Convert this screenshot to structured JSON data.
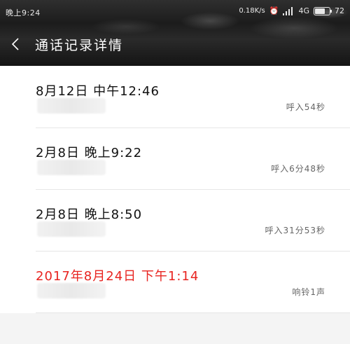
{
  "status_bar": {
    "time": "晚上9:24",
    "net_speed": "0.18K/s",
    "network": "4G",
    "battery": "72",
    "battery_level": 0.72
  },
  "header": {
    "title": "通话记录详情",
    "back_icon": "chevron-left-icon"
  },
  "records": [
    {
      "time": "8月12日 中午12:46",
      "desc": "呼入54秒",
      "missed": false
    },
    {
      "time": "2月8日 晚上9:22",
      "desc": "呼入6分48秒",
      "missed": false
    },
    {
      "time": "2月8日 晚上8:50",
      "desc": "呼入31分53秒",
      "missed": false
    },
    {
      "time": "2017年8月24日 下午1:14",
      "desc": "响铃1声",
      "missed": true
    }
  ],
  "colors": {
    "missed": "#e8231f",
    "header_bg": "#1c1c1c"
  }
}
